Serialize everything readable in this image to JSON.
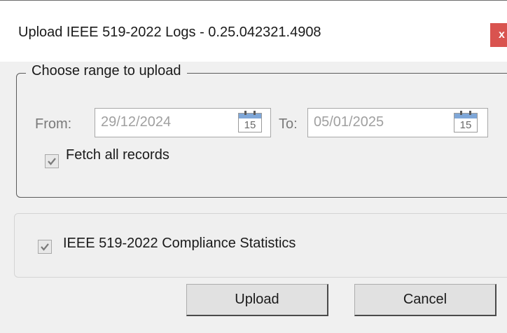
{
  "window": {
    "title": "Upload IEEE 519-2022 Logs - 0.25.042321.4908",
    "close_label": "x"
  },
  "range_group": {
    "legend": "Choose range to upload",
    "from_label": "From:",
    "from_value": "29/12/2024",
    "to_label": "To:",
    "to_value": "05/01/2025",
    "calendar_day": "15",
    "fetch_all_label": "Fetch all records",
    "fetch_all_checked": true
  },
  "stats": {
    "label": "IEEE 519-2022 Compliance Statistics",
    "checked": true
  },
  "buttons": {
    "upload": "Upload",
    "cancel": "Cancel"
  },
  "colors": {
    "close_bg": "#d9534f",
    "calendar_header": "#7fa7d8"
  },
  "icons": {
    "calendar": "calendar-icon",
    "check": "checkmark-icon",
    "close": "close-icon"
  }
}
